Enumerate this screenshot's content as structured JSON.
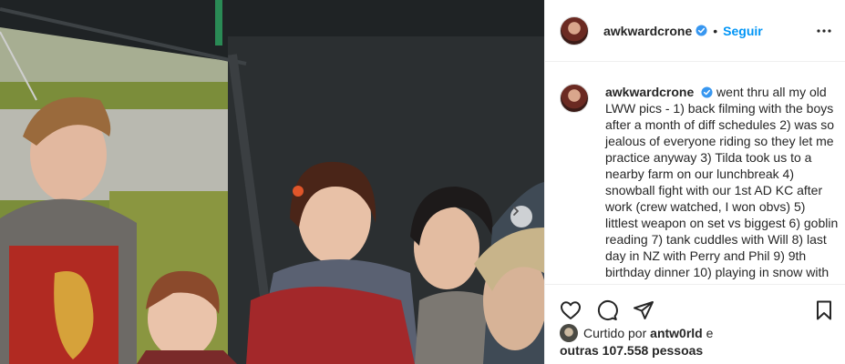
{
  "post": {
    "username": "awkwardcrone",
    "separator": "•",
    "follow_label": "Seguir",
    "caption": "went thru all my old LWW pics - 1) back filming with the boys after a month of diff schedules 2) was so jealous of everyone riding so they let me practice anyway 3) Tilda took us to a nearby farm on our lunchbreak 4) snowball fight with our 1st AD KC after work (crew watched, I won obvs) 5) littlest weapon on set vs biggest 6) goblin reading 7) tank cuddles with Will 8) last day in NZ with Perry and Phil 9) 9th birthday dinner 10) playing in snow with",
    "liked_by_prefix": "Curtido por",
    "liked_by_user": "antw0rld",
    "liked_by_conj": "e",
    "others": "outras 107.558 pessoas"
  },
  "icons": {
    "verified": "verified-badge-icon",
    "more": "more-options-icon",
    "next": "chevron-right-icon",
    "like": "heart-icon",
    "comment": "comment-icon",
    "share": "paper-plane-icon",
    "save": "bookmark-icon"
  },
  "colors": {
    "accent": "#0095f6",
    "text": "#262626",
    "border": "#efefef"
  }
}
